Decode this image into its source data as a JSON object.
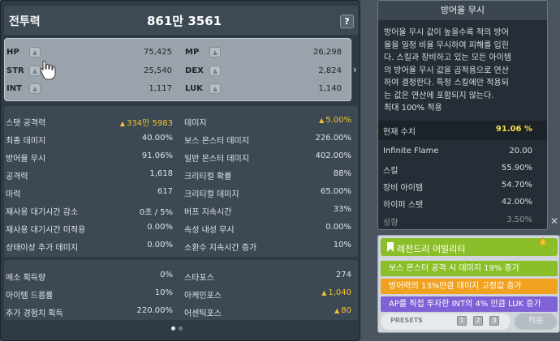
{
  "header": {
    "cp_label": "전투력",
    "cp_value": "861만 3561",
    "help_label": "?"
  },
  "ap_stats": [
    {
      "name": "HP",
      "value": "75,425"
    },
    {
      "name": "MP",
      "value": "26,298"
    },
    {
      "name": "STR",
      "value": "25,540"
    },
    {
      "name": "DEX",
      "value": "2,824"
    },
    {
      "name": "INT",
      "value": "1,117"
    },
    {
      "name": "LUK",
      "value": "1,140"
    }
  ],
  "ap_button_glyph": "▲",
  "detail_stats": [
    {
      "label": "스탯 공격력",
      "value": "334만 5983",
      "highlight": true
    },
    {
      "label": "데미지",
      "value": "5.00%",
      "highlight": true
    },
    {
      "label": "최종 데미지",
      "value": "40.00%"
    },
    {
      "label": "보스 몬스터 데미지",
      "value": "226.00%"
    },
    {
      "label": "방어율 무시",
      "value": "91.06%"
    },
    {
      "label": "일반 몬스터 데미지",
      "value": "402.00%"
    },
    {
      "label": "공격력",
      "value": "1,618"
    },
    {
      "label": "크리티컬 확률",
      "value": "88%"
    },
    {
      "label": "마력",
      "value": "617"
    },
    {
      "label": "크리티컬 데미지",
      "value": "65.00%"
    },
    {
      "label": "재사용 대기시간 감소",
      "value": "0초 / 5%"
    },
    {
      "label": "버프 지속시간",
      "value": "33%"
    },
    {
      "label": "재사용 대기시간 미적용",
      "value": "0.00%"
    },
    {
      "label": "속성 내성 무시",
      "value": "0.00%"
    },
    {
      "label": "상태이상 추가 데미지",
      "value": "0.00%"
    },
    {
      "label": "소환수 지속시간 증가",
      "value": "10%"
    }
  ],
  "drop_stats": [
    {
      "label": "메소 획득량",
      "value": "0%"
    },
    {
      "label": "스타포스",
      "value": "274"
    },
    {
      "label": "아이템 드롭률",
      "value": "10%"
    },
    {
      "label": "아케인포스",
      "value": "1,040",
      "highlight": true
    },
    {
      "label": "추가 경험치 획득",
      "value": "220.00%"
    },
    {
      "label": "어센틱포스",
      "value": "80",
      "highlight": true
    }
  ],
  "tooltip": {
    "title": "방어율 무시",
    "description_lines": [
      "방어율 무시 값이 높을수록 적의 방어",
      "율을 일정 비율 무시하여 피해를 입힌",
      "다. 스킬과 장비하고 있는 모든 아이템",
      "의 방어율 무시 값을 곱적용으로 연산",
      "하여 결정한다. 특정 스킬에만 적용되",
      "는 값은 연산에 포함되지 않는다.",
      "최대 100% 적용"
    ],
    "current_label": "현재 수치",
    "current_value": "91.06 %",
    "rows": [
      {
        "label": "Infinite Flame",
        "value": "20.00"
      },
      {
        "label": "스킬",
        "value": "55.90%"
      },
      {
        "label": "장비 아이템",
        "value": "54.70%"
      },
      {
        "label": "하이퍼 스탯",
        "value": "42.00%"
      },
      {
        "label": "성향",
        "value": "3.50%"
      }
    ]
  },
  "ability": {
    "title": "레전드리 어빌리티",
    "lines": [
      {
        "text": "보스 몬스터 공격 시 데미지 19% 증가",
        "color": "#8bbf2a"
      },
      {
        "text": "방어력의 13%만큼 데미지 고정값 증가",
        "color": "#f0a21e"
      },
      {
        "text": "AP를 직접 투자한 INT의 4% 만큼 LUK 증가",
        "color": "#7e62d6"
      }
    ],
    "presets_label": "PRESETS",
    "preset_numbers": [
      "1",
      "2",
      "3"
    ],
    "apply_label": "적용"
  },
  "colors": {
    "highlight_gold": "#f4c430",
    "legendary_green": "#8bbf2a"
  }
}
